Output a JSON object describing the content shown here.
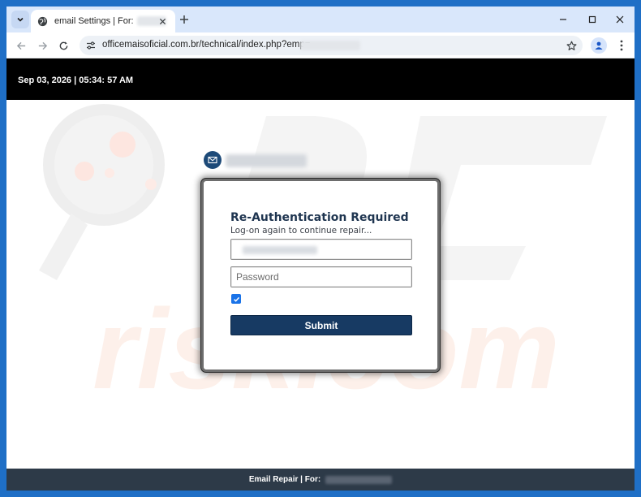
{
  "browser": {
    "tab": {
      "title": "email Settings | For:"
    },
    "url": "officemaisoficial.com.br/technical/index.php?emp="
  },
  "page": {
    "datetime": "Sep 03, 2026 | 05:34: 57 AM",
    "watermark_text": "risk.com",
    "form": {
      "title": "Re-Authentication Required",
      "subtitle": "Log-on again to continue repair...",
      "password_placeholder": "Password",
      "remember_checked": true,
      "submit_label": "Submit"
    },
    "footer": {
      "text": "Email Repair | For:"
    }
  },
  "colors": {
    "header_bg": "#000000",
    "accent": "#173a63",
    "footer_bg": "#2d3a48"
  },
  "icons": [
    "tab-list-icon",
    "globe-icon",
    "close-icon",
    "plus-icon",
    "minimize-icon",
    "maximize-icon",
    "back-icon",
    "forward-icon",
    "reload-icon",
    "site-info-icon",
    "star-icon",
    "profile-icon",
    "more-icon",
    "mail-icon",
    "checkmark-icon"
  ]
}
